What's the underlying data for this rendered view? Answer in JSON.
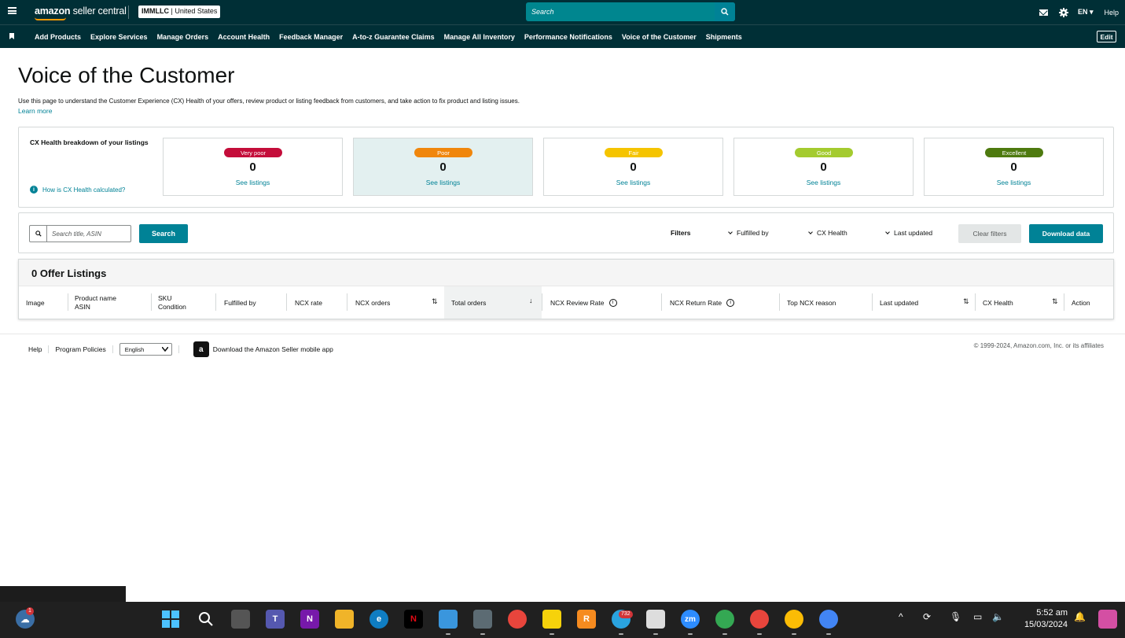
{
  "header": {
    "logo_bold": "amazon",
    "logo_light": " seller central",
    "account_name": "IMMLLC",
    "account_region": " | United States",
    "search_placeholder": "Search",
    "language": "EN",
    "help": "Help"
  },
  "nav": {
    "items": [
      "Add Products",
      "Explore Services",
      "Manage Orders",
      "Account Health",
      "Feedback Manager",
      "A-to-z Guarantee Claims",
      "Manage All Inventory",
      "Performance Notifications",
      "Voice of the Customer",
      "Shipments"
    ],
    "edit": "Edit"
  },
  "page": {
    "title": "Voice of the Customer",
    "description": "Use this page to understand the Customer Experience (CX) Health of your offers, review product or listing feedback from customers, and take action to fix product and listing issues.",
    "learn_more": "Learn more"
  },
  "cx_health": {
    "title": "CX Health breakdown of your listings",
    "calc_link": "How is CX Health calculated?",
    "cards": [
      {
        "label": "Very poor",
        "count": "0",
        "link": "See listings",
        "color": "#c40d3a"
      },
      {
        "label": "Poor",
        "count": "0",
        "link": "See listings",
        "color": "#f0860c"
      },
      {
        "label": "Fair",
        "count": "0",
        "link": "See listings",
        "color": "#f5c400"
      },
      {
        "label": "Good",
        "count": "0",
        "link": "See listings",
        "color": "#a4cb2f"
      },
      {
        "label": "Excellent",
        "count": "0",
        "link": "See listings",
        "color": "#4e7a0f"
      }
    ]
  },
  "filters": {
    "search_placeholder": "Search title, ASIN",
    "search_button": "Search",
    "label": "Filters",
    "dropdowns": [
      "Fulfilled by",
      "CX Health",
      "Last updated"
    ],
    "clear": "Clear filters",
    "download": "Download data"
  },
  "table": {
    "title": "0 Offer Listings",
    "columns": [
      "Image",
      "Product name",
      "ASIN",
      "SKU",
      "Condition",
      "Fulfilled by",
      "NCX rate",
      "NCX orders",
      "Total orders",
      "NCX Review Rate",
      "NCX Return Rate",
      "Top NCX reason",
      "Last updated",
      "CX Health",
      "Action"
    ]
  },
  "footer": {
    "help": "Help",
    "policies": "Program Policies",
    "language": "English",
    "app": "Download the Amazon Seller mobile app",
    "copyright": "© 1999-2024, Amazon.com, Inc. or its affiliates"
  },
  "taskbar": {
    "weather_badge": "1",
    "telegram_badge": "732",
    "time": "5:52 am",
    "date": "15/03/2024"
  },
  "colors": {
    "header_bg": "#002f36",
    "accent": "#008296"
  }
}
